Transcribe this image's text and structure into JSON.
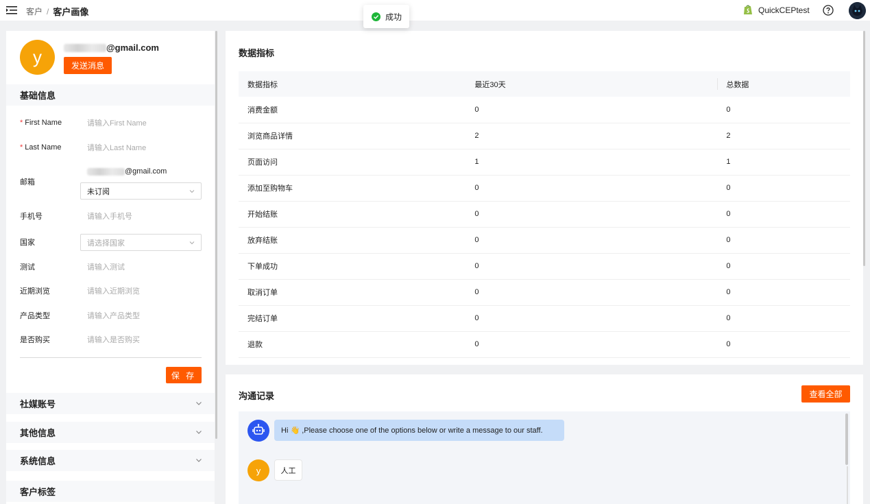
{
  "header": {
    "breadcrumb_parent": "客户",
    "breadcrumb_sep": "/",
    "breadcrumb_current": "客户画像",
    "shop_name": "QuickCEPtest"
  },
  "toast": {
    "text": "成功"
  },
  "profile": {
    "avatar_letter": "y",
    "email_suffix": "@gmail.com",
    "send_message": "发送消息"
  },
  "basic_info": {
    "title": "基础信息",
    "first_name_label": "First Name",
    "first_name_placeholder": "请输入First Name",
    "last_name_label": "Last Name",
    "last_name_placeholder": "请输入Last Name",
    "email_label": "邮箱",
    "email_suffix": "@gmail.com",
    "subscription_value": "未订阅",
    "phone_label": "手机号",
    "phone_placeholder": "请输入手机号",
    "country_label": "国家",
    "country_placeholder": "请选择国家",
    "test_label": "测试",
    "test_placeholder": "请输入测试",
    "recent_label": "近期浏览",
    "recent_placeholder": "请输入近期浏览",
    "product_type_label": "产品类型",
    "product_type_placeholder": "请输入产品类型",
    "purchased_label": "是否购买",
    "purchased_placeholder": "请输入是否购买",
    "save": "保 存"
  },
  "sections": {
    "social": "社媒账号",
    "other": "其他信息",
    "system": "系统信息",
    "tags": "客户标签"
  },
  "metrics": {
    "title": "数据指标",
    "columns": [
      "数据指标",
      "最近30天",
      "总数据"
    ],
    "rows": [
      [
        "消费金额",
        "0",
        "0"
      ],
      [
        "浏览商品详情",
        "2",
        "2"
      ],
      [
        "页面访问",
        "1",
        "1"
      ],
      [
        "添加至购物车",
        "0",
        "0"
      ],
      [
        "开始结账",
        "0",
        "0"
      ],
      [
        "放弃结账",
        "0",
        "0"
      ],
      [
        "下单成功",
        "0",
        "0"
      ],
      [
        "取消订单",
        "0",
        "0"
      ],
      [
        "完结订单",
        "0",
        "0"
      ],
      [
        "退款",
        "0",
        "0"
      ]
    ]
  },
  "communication": {
    "title": "沟通记录",
    "view_all": "查看全部",
    "bot_message": "Hi 👋 ,Please choose one of the options below or write a message to our staff.",
    "user_letter": "y",
    "user_message": "人工"
  },
  "colors": {
    "accent": "#ff5a00",
    "avatar": "#f6a308",
    "bot": "#2c56f0",
    "bot_bubble": "#c5dcf9",
    "success": "#1db538"
  }
}
